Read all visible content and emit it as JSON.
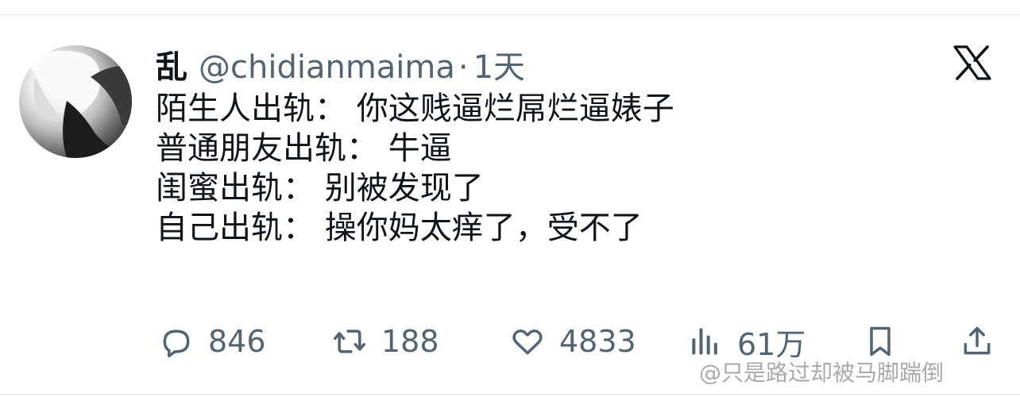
{
  "tweet": {
    "display_name": "乱",
    "handle": "@chidianmaima",
    "separator": "·",
    "time": "1天",
    "lines": [
      "陌生人出轨：  你这贱逼烂屌烂逼婊子",
      "普通朋友出轨：  牛逼",
      "闺蜜出轨：  别被发现了",
      "自己出轨：  操你妈太痒了，受不了"
    ]
  },
  "actions": {
    "reply_count": "846",
    "retweet_count": "188",
    "like_count": "4833",
    "views_count": "61万"
  },
  "icons": {
    "reply": "speech-bubble-icon",
    "retweet": "retweet-arrows-icon",
    "like": "heart-icon",
    "views": "bar-chart-icon",
    "bookmark": "bookmark-icon",
    "share": "share-upload-icon",
    "logo": "x-logo-icon"
  },
  "watermark": "@只是路过却被马脚踹倒",
  "colors": {
    "text": "#0f1419",
    "secondary": "#536471",
    "watermark": "#a9a9a9"
  }
}
